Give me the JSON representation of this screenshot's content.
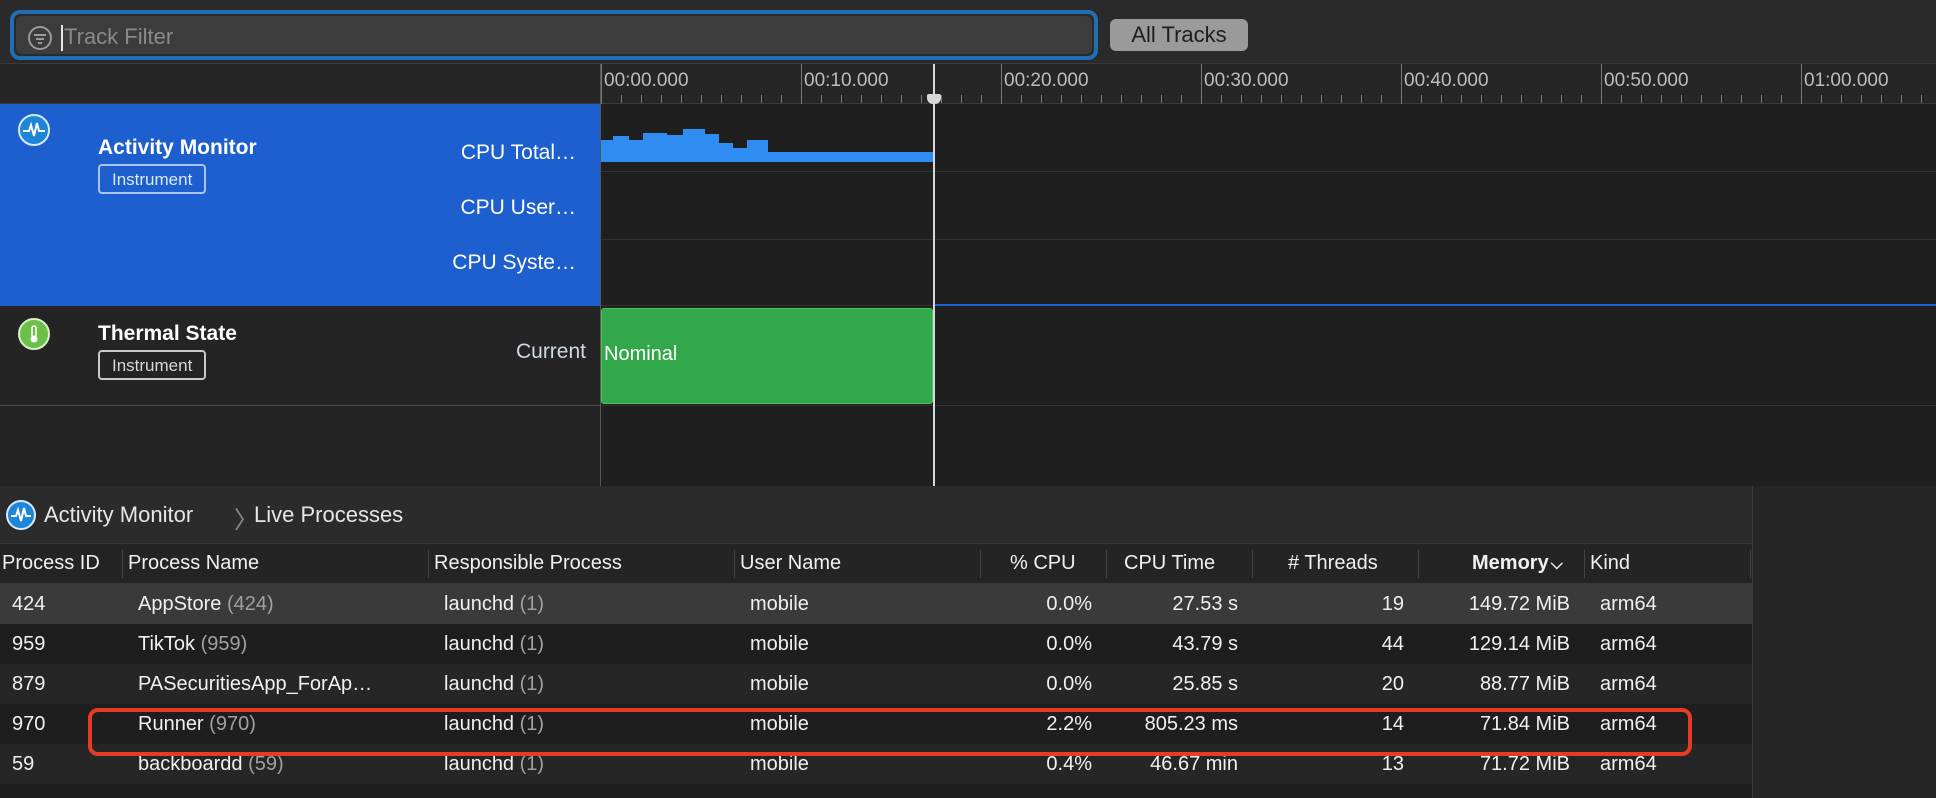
{
  "filter": {
    "placeholder": "Track Filter",
    "value": "",
    "all_tracks_label": "All Tracks"
  },
  "ruler": {
    "labels": [
      "00:00.000",
      "00:10.000",
      "00:20.000",
      "00:30.000",
      "00:40.000",
      "00:50.000",
      "01:00.000"
    ]
  },
  "tracks": {
    "activity": {
      "title": "Activity Monitor",
      "badge": "Instrument",
      "lanes": [
        "CPU Total…",
        "CPU User…",
        "CPU Syste…"
      ]
    },
    "thermal": {
      "title": "Thermal State",
      "badge": "Instrument",
      "lane": "Current",
      "state": "Nominal"
    }
  },
  "colors": {
    "selected_track": "#1d5fce",
    "cpu_fill": "#2f8cf0",
    "thermal_ok": "#33a84a",
    "highlight": "#e63b24"
  },
  "breadcrumb": {
    "root": "Activity Monitor",
    "current": "Live Processes"
  },
  "table": {
    "columns": [
      "Process ID",
      "Process Name",
      "Responsible Process",
      "User Name",
      "% CPU",
      "CPU Time",
      "# Threads",
      "Memory",
      "Kind"
    ],
    "sort_column": "Memory",
    "rows": [
      {
        "pid": "424",
        "name": "AppStore",
        "name_pid": "(424)",
        "resp": "launchd",
        "resp_pid": "(1)",
        "user": "mobile",
        "cpu": "0.0%",
        "cpu_time": "27.53 s",
        "threads": "19",
        "memory": "149.72 MiB",
        "kind": "arm64"
      },
      {
        "pid": "959",
        "name": "TikTok",
        "name_pid": "(959)",
        "resp": "launchd",
        "resp_pid": "(1)",
        "user": "mobile",
        "cpu": "0.0%",
        "cpu_time": "43.79 s",
        "threads": "44",
        "memory": "129.14 MiB",
        "kind": "arm64"
      },
      {
        "pid": "879",
        "name": "PASecuritiesApp_ForAp…",
        "name_pid": "",
        "resp": "launchd",
        "resp_pid": "(1)",
        "user": "mobile",
        "cpu": "0.0%",
        "cpu_time": "25.85 s",
        "threads": "20",
        "memory": "88.77 MiB",
        "kind": "arm64"
      },
      {
        "pid": "970",
        "name": "Runner",
        "name_pid": "(970)",
        "resp": "launchd",
        "resp_pid": "(1)",
        "user": "mobile",
        "cpu": "2.2%",
        "cpu_time": "805.23 ms",
        "threads": "14",
        "memory": "71.84 MiB",
        "kind": "arm64"
      },
      {
        "pid": "59",
        "name": "backboardd",
        "name_pid": "(59)",
        "resp": "launchd",
        "resp_pid": "(1)",
        "user": "mobile",
        "cpu": "0.4%",
        "cpu_time": "46.67 min",
        "threads": "13",
        "memory": "71.72 MiB",
        "kind": "arm64"
      }
    ]
  }
}
